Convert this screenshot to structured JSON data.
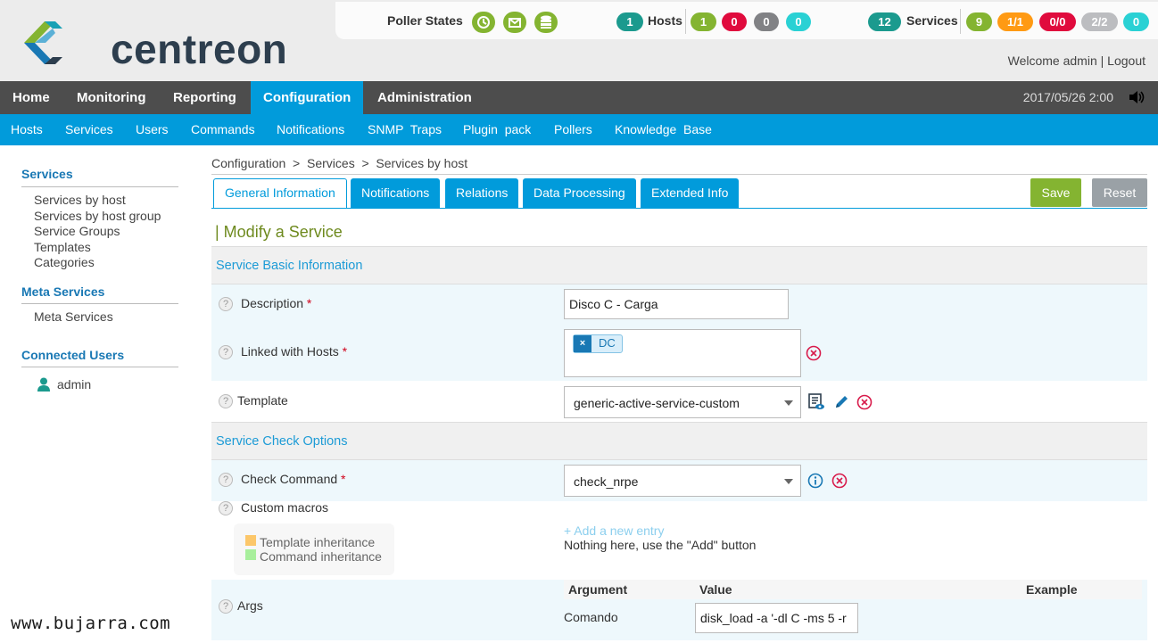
{
  "header": {
    "logo_text": "centreon",
    "poller_states_label": "Poller States",
    "hosts": {
      "label": "Hosts",
      "total": "1",
      "up": "1",
      "down": "0",
      "unreachable": "0",
      "pending": "0"
    },
    "services": {
      "label": "Services",
      "total": "12",
      "ok": "9",
      "warning": "1/1",
      "critical": "0/0",
      "unknown": "2/2",
      "pending": "0"
    },
    "welcome": "Welcome admin",
    "separator": "|",
    "logout": "Logout",
    "datetime": "2017/05/26 2:00"
  },
  "main_menu": [
    "Home",
    "Monitoring",
    "Reporting",
    "Configuration",
    "Administration"
  ],
  "sub_menu": [
    "Hosts",
    "Services",
    "Users",
    "Commands",
    "Notifications",
    "SNMP  Traps",
    "Plugin  pack",
    "Pollers",
    "Knowledge  Base"
  ],
  "sidebar": {
    "services_title": "Services",
    "services_links": [
      "Services by host",
      "Services by host group",
      "Service Groups",
      "Templates",
      "Categories"
    ],
    "meta_title": "Meta Services",
    "meta_links": [
      "Meta Services"
    ],
    "connected_title": "Connected Users",
    "users": [
      "admin"
    ]
  },
  "breadcrumb": "Configuration  >  Services  >  Services by host",
  "tabs": [
    "General Information",
    "Notifications",
    "Relations",
    "Data Processing",
    "Extended Info"
  ],
  "buttons": {
    "save": "Save",
    "reset": "Reset"
  },
  "form": {
    "title": "| Modify a Service",
    "section_basic": "Service Basic Information",
    "description_label": "Description",
    "description_value": "Disco C - Carga",
    "linked_hosts_label": "Linked with Hosts",
    "linked_hosts_tags": [
      "DC"
    ],
    "template_label": "Template",
    "template_value": "generic-active-service-custom",
    "section_check": "Service Check Options",
    "check_command_label": "Check Command",
    "check_command_value": "check_nrpe",
    "custom_macros_label": "Custom macros",
    "legend_template": "Template inheritance",
    "legend_command": "Command inheritance",
    "add_entry": "+ Add a new entry",
    "nothing_here": "Nothing here, use the \"Add\" button",
    "args_label": "Args",
    "args_headers": [
      "Argument",
      "Value",
      "Example"
    ],
    "args_row_argument": "Comando",
    "args_row_value": "disk_load -a '-dl C -ms 5 -r",
    "required_mark": "*",
    "help_mark": "?"
  },
  "watermark": "www.bujarra.com",
  "colors": {
    "accent_blue": "#019bdb",
    "menu_dark": "#4d4d4d",
    "ok_green": "#84b431",
    "critical_red": "#e00b3d",
    "warning_orange": "#ff9a13",
    "unknown_gray": "#bcbdc0",
    "pending_cyan": "#2ad1d4",
    "up_teal": "#1b9a8e"
  },
  "icons": {
    "poller_icons": [
      "clock-icon",
      "mail-icon",
      "database-icon"
    ],
    "template_actions": [
      "view-template-icon",
      "edit-pencil-icon",
      "remove-circle-icon"
    ],
    "check_command_actions": [
      "info-circle-icon",
      "remove-circle-icon"
    ],
    "sound": "speaker-icon",
    "user": "user-icon"
  }
}
